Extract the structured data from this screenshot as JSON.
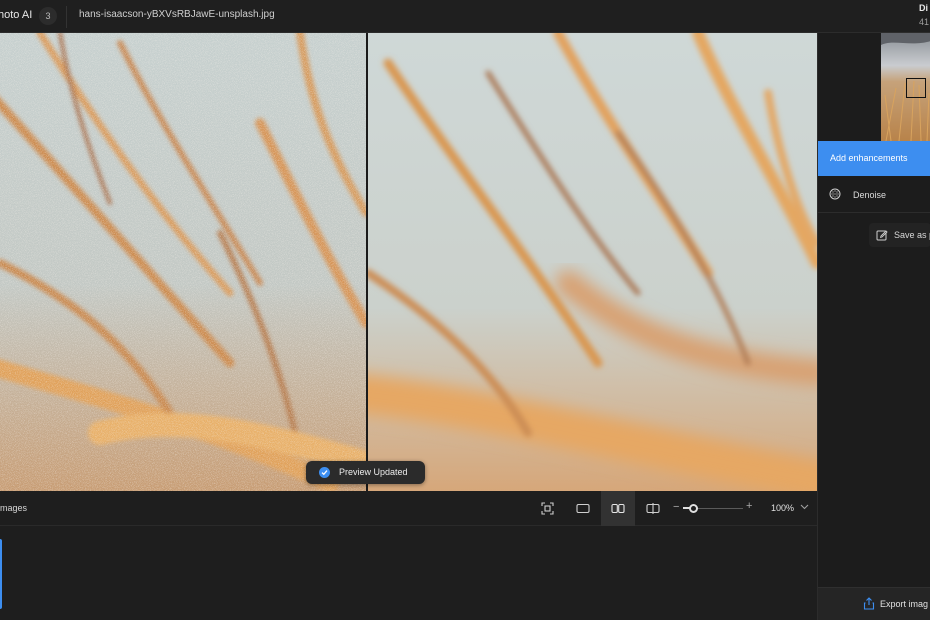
{
  "titlebar": {
    "app_name": "hoto AI",
    "app_count": "3",
    "filename": "hans-isaacson-yBXVsRBJawE-unsplash.jpg",
    "right_title": "Di",
    "right_subtitle": "41"
  },
  "viewer": {
    "toast_text": "Preview Updated"
  },
  "toolbar": {
    "images_label": "images",
    "zoom_minus": "−",
    "zoom_plus": "+",
    "zoom_value": "100%",
    "zoom_slider_fraction": 0.17
  },
  "panel": {
    "add_enhancements_label": "Add enhancements",
    "denoise_label": "Denoise",
    "save_preset_label": "Save as p",
    "export_label": "Export imag"
  },
  "colors": {
    "accent": "#3d8ef0",
    "background": "#1e1e1e"
  }
}
